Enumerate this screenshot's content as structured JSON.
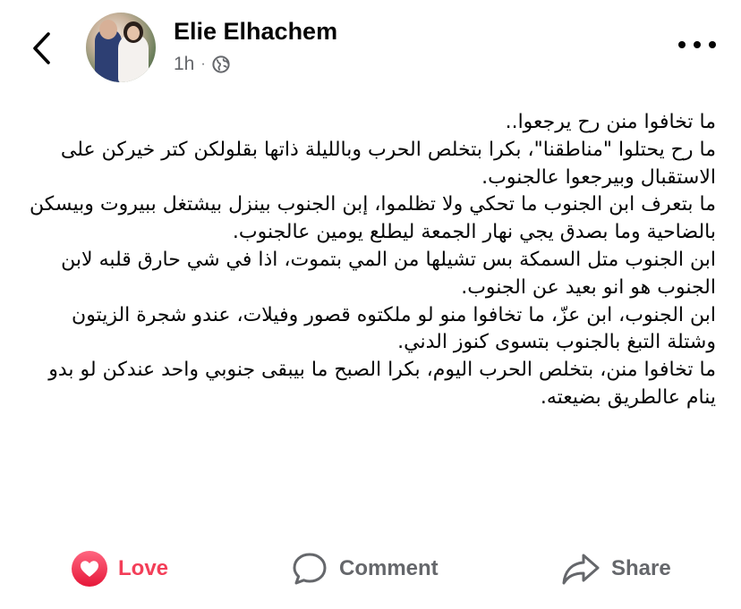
{
  "author": {
    "name": "Elie Elhachem",
    "time": "1h",
    "separator": "·",
    "privacy_icon": "globe-icon"
  },
  "header": {
    "back_icon": "chevron-left-icon",
    "more_icon": "more-horizontal-icon"
  },
  "post": {
    "paragraphs": [
      "ما تخافوا منن رح يرجعوا..",
      "ما رح يحتلوا \"مناطقنا\"، بكرا بتخلص الحرب وبالليلة ذاتها بقلولكن كتر خيركن على الاستقبال وبيرجعوا عالجنوب.",
      "ما بتعرف ابن الجنوب ما تحكي ولا تظلموا، إبن الجنوب بينزل بيشتغل ببيروت وبيسكن بالضاحية وما بصدق يجي نهار الجمعة ليطلع يومين عالجنوب.",
      "ابن الجنوب متل السمكة بس تشيلها من المي بتموت، اذا في شي حارق قلبه لابن الجنوب هو انو بعيد عن الجنوب.",
      "ابن الجنوب، ابن عزّ، ما تخافوا منو لو ملكتوه قصور وفيلات، عندو شجرة الزيتون وشتلة التبغ بالجنوب بتسوى كنوز الدني.",
      "ما تخافوا منن، بتخلص الحرب اليوم، بكرا الصبح ما بيبقى جنوبي واحد عندكن لو بدو ينام عالطريق بضيعته."
    ]
  },
  "actions": {
    "love_label": "Love",
    "comment_label": "Comment",
    "share_label": "Share"
  },
  "colors": {
    "love": "#f33e58",
    "secondary_text": "#65676b",
    "primary_text": "#050505"
  }
}
